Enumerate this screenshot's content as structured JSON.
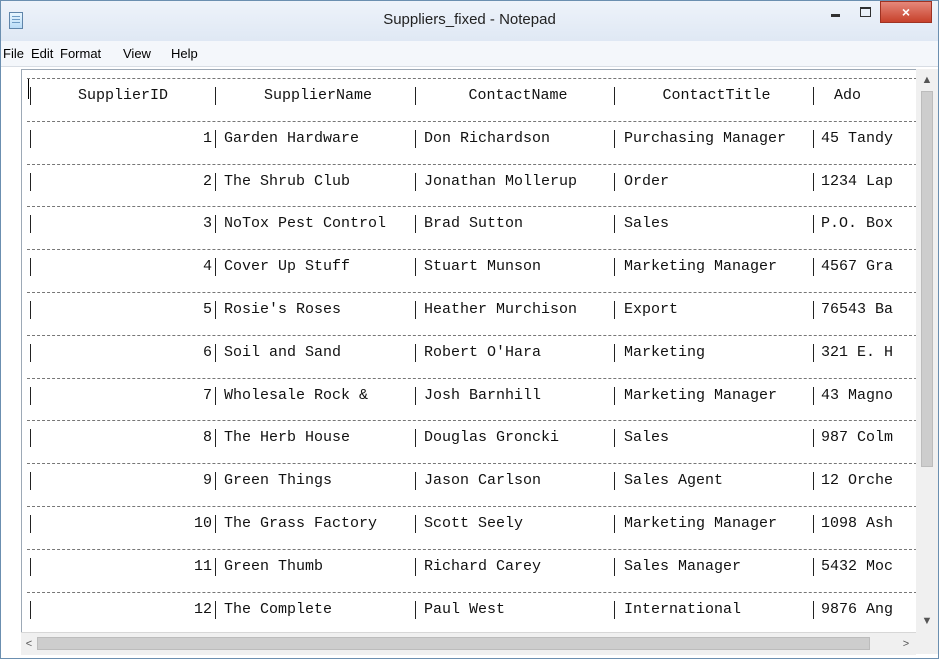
{
  "window": {
    "title": "Suppliers_fixed - Notepad",
    "controls": {
      "minimize": "minimize-icon",
      "maximize": "maximize-icon",
      "close": "×"
    },
    "colors": {
      "title_bar": "#dfe8f4",
      "close_button": "#c7412b",
      "menu_bar": "#f4f7fb"
    }
  },
  "menu": {
    "items": [
      {
        "label": "File"
      },
      {
        "label": "Edit"
      },
      {
        "label": "Format"
      },
      {
        "label": "View"
      },
      {
        "label": "Help"
      }
    ]
  },
  "table": {
    "headers": [
      "SupplierID",
      "SupplierName",
      "ContactName",
      "ContactTitle",
      "Ado"
    ],
    "rows": [
      [
        "1",
        "Garden Hardware",
        "Don Richardson",
        "Purchasing Manager",
        "45 Tandy"
      ],
      [
        "2",
        "The Shrub Club",
        "Jonathan Mollerup",
        "Order",
        "1234 Lap"
      ],
      [
        "3",
        "NoTox Pest Control",
        "Brad Sutton",
        "Sales",
        "P.O. Box"
      ],
      [
        "4",
        "Cover Up Stuff",
        "Stuart Munson",
        "Marketing Manager",
        "4567 Gra"
      ],
      [
        "5",
        "Rosie's Roses",
        "Heather Murchison",
        "Export",
        "76543 Ba"
      ],
      [
        "6",
        "Soil and Sand",
        "Robert O'Hara",
        "Marketing",
        "321 E. H"
      ],
      [
        "7",
        "Wholesale Rock &",
        "Josh Barnhill",
        "Marketing Manager",
        "43 Magno"
      ],
      [
        "8",
        "The Herb House",
        "Douglas Groncki",
        "Sales",
        "987 Colm"
      ],
      [
        "9",
        "Green Things",
        "Jason Carlson",
        "Sales Agent",
        "12 Orche"
      ],
      [
        "10",
        "The Grass Factory",
        "Scott Seely",
        "Marketing Manager",
        "1098 Ash"
      ],
      [
        "11",
        "Green Thumb",
        "Richard Carey",
        "Sales Manager",
        "5432 Moc"
      ],
      [
        "12",
        "The Complete",
        "Paul West",
        "International",
        "9876 Ang"
      ]
    ]
  },
  "scrollbars": {
    "up": "▲",
    "down": "▼",
    "left": "<",
    "right": ">"
  }
}
